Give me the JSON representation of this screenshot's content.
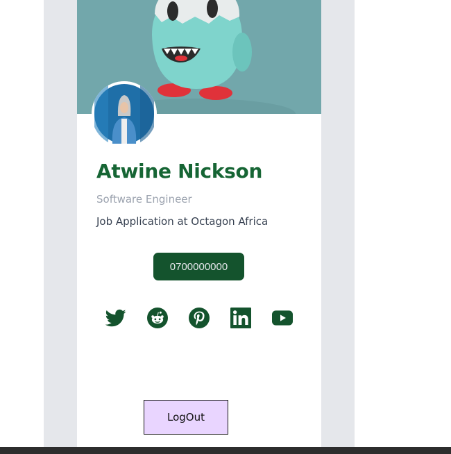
{
  "profile": {
    "name": "Atwine Nickson",
    "title": "Software Engineer",
    "subtitle": "Job Application at Octagon Africa",
    "phone": "0700000000"
  },
  "social": [
    {
      "icon": "twitter-icon"
    },
    {
      "icon": "reddit-icon"
    },
    {
      "icon": "pinterest-icon"
    },
    {
      "icon": "linkedin-icon"
    },
    {
      "icon": "youtube-icon"
    }
  ],
  "actions": {
    "logout_label": "LogOut"
  },
  "colors": {
    "accent": "#166534",
    "button_bg": "#14532d",
    "logout_bg": "#e9d5ff",
    "panel_bg": "#e5e7eb",
    "cover_bg": "#6fa3a8"
  }
}
